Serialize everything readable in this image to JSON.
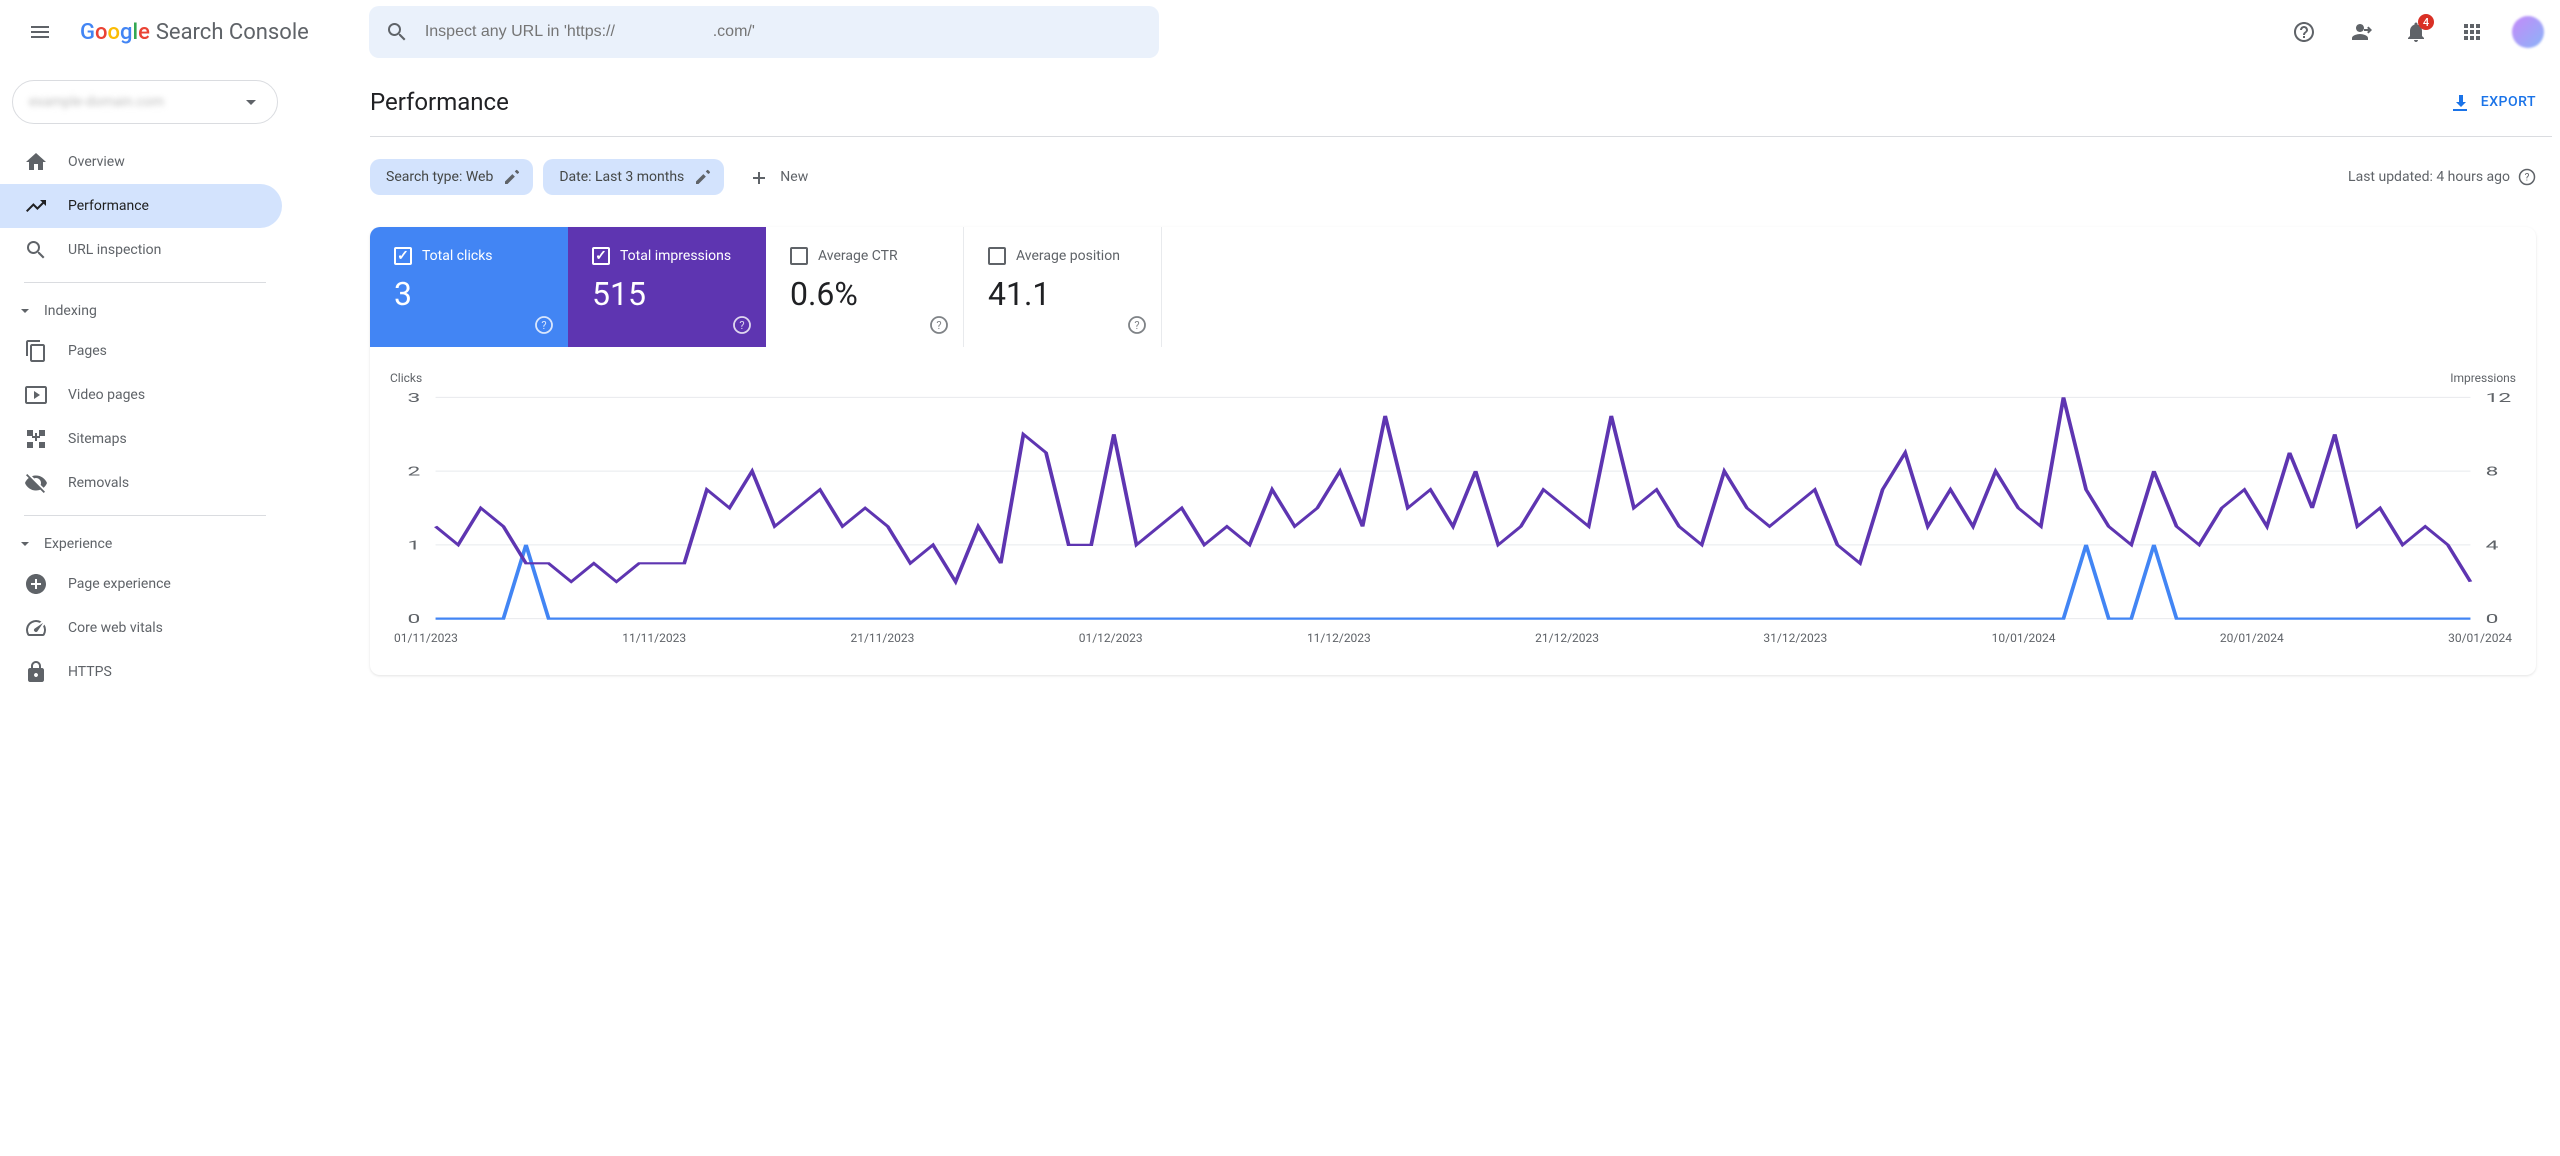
{
  "header": {
    "product_name": "Search Console",
    "search_placeholder": "Inspect any URL in 'https://                      .com/'",
    "notification_count": "4"
  },
  "sidebar": {
    "property_domain": "example-domain.com",
    "items": [
      {
        "label": "Overview"
      },
      {
        "label": "Performance"
      },
      {
        "label": "URL inspection"
      }
    ],
    "sections": [
      {
        "title": "Indexing",
        "items": [
          {
            "label": "Pages"
          },
          {
            "label": "Video pages"
          },
          {
            "label": "Sitemaps"
          },
          {
            "label": "Removals"
          }
        ]
      },
      {
        "title": "Experience",
        "items": [
          {
            "label": "Page experience"
          },
          {
            "label": "Core web vitals"
          },
          {
            "label": "HTTPS"
          }
        ]
      }
    ]
  },
  "page": {
    "title": "Performance",
    "export_label": "EXPORT",
    "filters": {
      "search_type": "Search type: Web",
      "date": "Date: Last 3 months",
      "new_label": "New"
    },
    "last_updated": "Last updated: 4 hours ago",
    "metrics": {
      "clicks": {
        "label": "Total clicks",
        "value": "3"
      },
      "impressions": {
        "label": "Total impressions",
        "value": "515"
      },
      "ctr": {
        "label": "Average CTR",
        "value": "0.6%"
      },
      "position": {
        "label": "Average position",
        "value": "41.1"
      }
    },
    "chart": {
      "left_label": "Clicks",
      "right_label": "Impressions",
      "left_ticks": [
        "3",
        "2",
        "1",
        "0"
      ],
      "right_ticks": [
        "12",
        "8",
        "4",
        "0"
      ],
      "x_ticks": [
        "01/11/2023",
        "11/11/2023",
        "21/11/2023",
        "01/12/2023",
        "11/12/2023",
        "21/12/2023",
        "31/12/2023",
        "10/01/2024",
        "20/01/2024",
        "30/01/2024"
      ]
    }
  },
  "chart_data": {
    "type": "line",
    "title": "Performance",
    "x": [
      "01/11/2023",
      "02/11/2023",
      "03/11/2023",
      "04/11/2023",
      "05/11/2023",
      "06/11/2023",
      "07/11/2023",
      "08/11/2023",
      "09/11/2023",
      "10/11/2023",
      "11/11/2023",
      "12/11/2023",
      "13/11/2023",
      "14/11/2023",
      "15/11/2023",
      "16/11/2023",
      "17/11/2023",
      "18/11/2023",
      "19/11/2023",
      "20/11/2023",
      "21/11/2023",
      "22/11/2023",
      "23/11/2023",
      "24/11/2023",
      "25/11/2023",
      "26/11/2023",
      "27/11/2023",
      "28/11/2023",
      "29/11/2023",
      "30/11/2023",
      "01/12/2023",
      "02/12/2023",
      "03/12/2023",
      "04/12/2023",
      "05/12/2023",
      "06/12/2023",
      "07/12/2023",
      "08/12/2023",
      "09/12/2023",
      "10/12/2023",
      "11/12/2023",
      "12/12/2023",
      "13/12/2023",
      "14/12/2023",
      "15/12/2023",
      "16/12/2023",
      "17/12/2023",
      "18/12/2023",
      "19/12/2023",
      "20/12/2023",
      "21/12/2023",
      "22/12/2023",
      "23/12/2023",
      "24/12/2023",
      "25/12/2023",
      "26/12/2023",
      "27/12/2023",
      "28/12/2023",
      "29/12/2023",
      "30/12/2023",
      "31/12/2023",
      "01/01/2024",
      "02/01/2024",
      "03/01/2024",
      "04/01/2024",
      "05/01/2024",
      "06/01/2024",
      "07/01/2024",
      "08/01/2024",
      "09/01/2024",
      "10/01/2024",
      "11/01/2024",
      "12/01/2024",
      "13/01/2024",
      "14/01/2024",
      "15/01/2024",
      "16/01/2024",
      "17/01/2024",
      "18/01/2024",
      "19/01/2024",
      "20/01/2024",
      "21/01/2024",
      "22/01/2024",
      "23/01/2024",
      "24/01/2024",
      "25/01/2024",
      "26/01/2024",
      "27/01/2024",
      "28/01/2024",
      "29/01/2024",
      "30/01/2024"
    ],
    "series": [
      {
        "name": "Clicks",
        "axis": "left",
        "color": "#4285f4",
        "values": [
          0,
          0,
          0,
          0,
          1,
          0,
          0,
          0,
          0,
          0,
          0,
          0,
          0,
          0,
          0,
          0,
          0,
          0,
          0,
          0,
          0,
          0,
          0,
          0,
          0,
          0,
          0,
          0,
          0,
          0,
          0,
          0,
          0,
          0,
          0,
          0,
          0,
          0,
          0,
          0,
          0,
          0,
          0,
          0,
          0,
          0,
          0,
          0,
          0,
          0,
          0,
          0,
          0,
          0,
          0,
          0,
          0,
          0,
          0,
          0,
          0,
          0,
          0,
          0,
          0,
          0,
          0,
          0,
          0,
          0,
          0,
          0,
          0,
          1,
          0,
          0,
          1,
          0,
          0,
          0,
          0,
          0,
          0,
          0,
          0,
          0,
          0,
          0,
          0,
          0,
          0
        ]
      },
      {
        "name": "Impressions",
        "axis": "right",
        "color": "#5e35b1",
        "values": [
          5,
          4,
          6,
          5,
          3,
          3,
          2,
          3,
          2,
          3,
          3,
          3,
          7,
          6,
          8,
          5,
          6,
          7,
          5,
          6,
          5,
          3,
          4,
          2,
          5,
          3,
          10,
          9,
          4,
          4,
          10,
          4,
          5,
          6,
          4,
          5,
          4,
          7,
          5,
          6,
          8,
          5,
          11,
          6,
          7,
          5,
          8,
          4,
          5,
          7,
          6,
          5,
          11,
          6,
          7,
          5,
          4,
          8,
          6,
          5,
          6,
          7,
          4,
          3,
          7,
          9,
          5,
          7,
          5,
          8,
          6,
          5,
          12,
          7,
          5,
          4,
          8,
          5,
          4,
          6,
          7,
          5,
          9,
          6,
          10,
          5,
          6,
          4,
          5,
          4,
          2
        ]
      }
    ],
    "left_axis": {
      "label": "Clicks",
      "range": [
        0,
        3
      ]
    },
    "right_axis": {
      "label": "Impressions",
      "range": [
        0,
        12
      ]
    }
  }
}
